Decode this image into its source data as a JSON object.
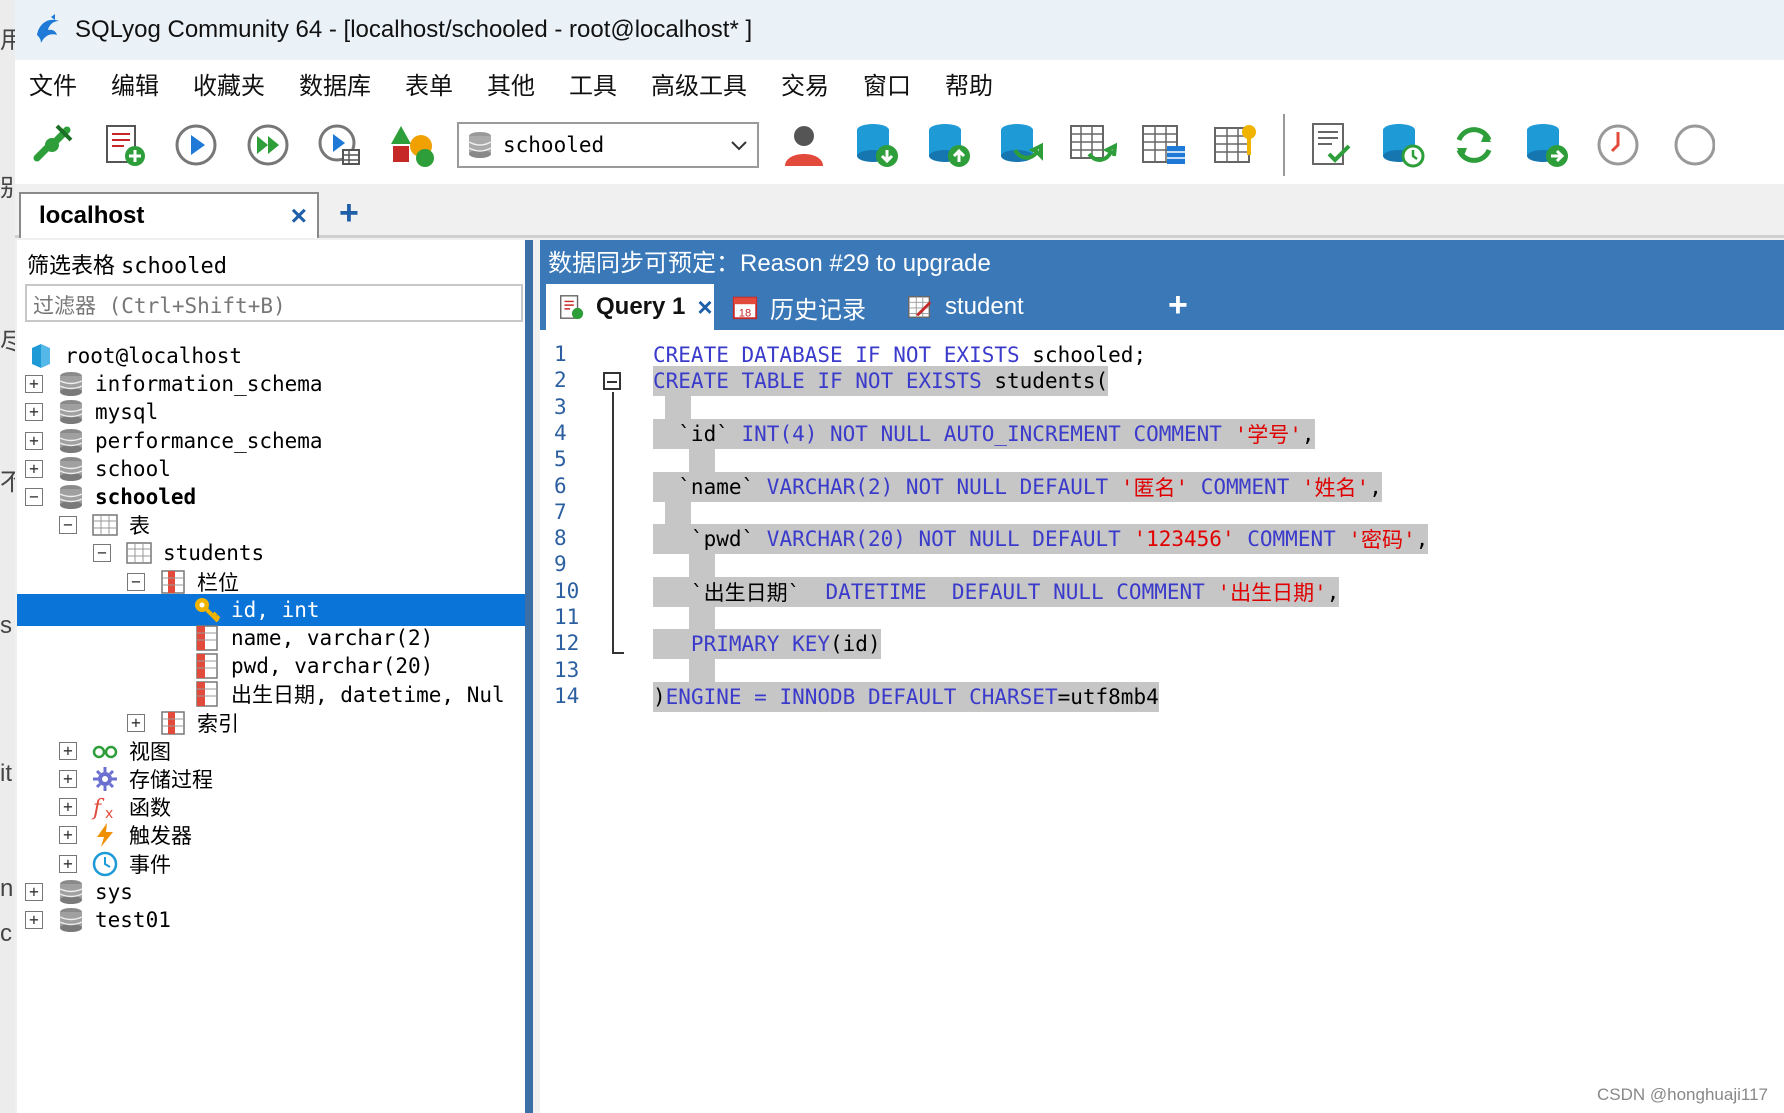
{
  "window": {
    "title": "SQLyog Community 64 - [localhost/schooled - root@localhost* ]"
  },
  "menu": [
    "文件",
    "编辑",
    "收藏夹",
    "数据库",
    "表单",
    "其他",
    "工具",
    "高级工具",
    "交易",
    "窗口",
    "帮助"
  ],
  "toolbar": {
    "db_selector_value": "schooled",
    "icons": [
      "connect-icon",
      "new-query-icon",
      "execute-query-icon",
      "execute-all-icon",
      "execute-results-icon",
      "schema-designer-icon",
      "user-manager-icon",
      "backup-icon",
      "restore-icon",
      "db-sync-icon",
      "import-table-icon",
      "table-data-icon",
      "index-icon",
      "query-builder-icon",
      "schedule-icon",
      "refresh-icon",
      "import-external-icon",
      "history-clock-icon"
    ]
  },
  "connection_tab": {
    "label": "localhost",
    "close": "×",
    "add": "+"
  },
  "left_panel": {
    "filter_title": "筛选表格",
    "filter_db": "schooled",
    "filter_placeholder": "过滤器 (Ctrl+Shift+B)",
    "tree": [
      {
        "label": "root@localhost",
        "icon": "server-icon",
        "level": 0,
        "expander": ""
      },
      {
        "label": "information_schema",
        "icon": "database-icon",
        "level": 0,
        "expander": "+"
      },
      {
        "label": "mysql",
        "icon": "database-icon",
        "level": 0,
        "expander": "+"
      },
      {
        "label": "performance_schema",
        "icon": "database-icon",
        "level": 0,
        "expander": "+"
      },
      {
        "label": "school",
        "icon": "database-icon",
        "level": 0,
        "expander": "+"
      },
      {
        "label": "schooled",
        "icon": "database-icon",
        "level": 0,
        "expander": "−",
        "bold": true
      },
      {
        "label": "表",
        "icon": "tables-folder-icon",
        "level": 1,
        "expander": "−"
      },
      {
        "label": "students",
        "icon": "table-icon",
        "level": 2,
        "expander": "−"
      },
      {
        "label": "栏位",
        "icon": "columns-icon",
        "level": 3,
        "expander": "−"
      },
      {
        "label": "id, int",
        "icon": "primary-key-icon",
        "level": 4,
        "expander": "",
        "selected": true
      },
      {
        "label": "name, varchar(2)",
        "icon": "column-icon",
        "level": 4,
        "expander": ""
      },
      {
        "label": "pwd, varchar(20)",
        "icon": "column-icon",
        "level": 4,
        "expander": ""
      },
      {
        "label": "出生日期, datetime, Nul",
        "icon": "column-icon",
        "level": 4,
        "expander": ""
      },
      {
        "label": "索引",
        "icon": "index-folder-icon",
        "level": 3,
        "expander": "+"
      },
      {
        "label": "视图",
        "icon": "views-icon",
        "level": 1,
        "expander": "+"
      },
      {
        "label": "存储过程",
        "icon": "procedures-icon",
        "level": 1,
        "expander": "+"
      },
      {
        "label": "函数",
        "icon": "functions-icon",
        "level": 1,
        "expander": "+"
      },
      {
        "label": "触发器",
        "icon": "triggers-icon",
        "level": 1,
        "expander": "+"
      },
      {
        "label": "事件",
        "icon": "events-icon",
        "level": 1,
        "expander": "+"
      },
      {
        "label": "sys",
        "icon": "database-icon",
        "level": 0,
        "expander": "+"
      },
      {
        "label": "test01",
        "icon": "database-icon",
        "level": 0,
        "expander": "+"
      }
    ]
  },
  "right_panel": {
    "banner": "数据同步可预定：Reason #29 to upgrade",
    "tabs": [
      {
        "label": "Query 1",
        "icon": "query-tab-icon",
        "active": true,
        "close": "×"
      },
      {
        "label": "历史记录",
        "icon": "calendar-icon",
        "calendar_day": "18"
      },
      {
        "label": "student",
        "icon": "table-edit-icon"
      }
    ],
    "add_tab": "+",
    "line_numbers": [
      "1",
      "2",
      "3",
      "4",
      "5",
      "6",
      "7",
      "8",
      "9",
      "10",
      "11",
      "12",
      "13",
      "14"
    ],
    "code_lines": [
      [
        {
          "t": "CREATE DATABASE IF NOT EXISTS",
          "c": "kw"
        },
        {
          "t": " schooled;",
          "c": "id"
        }
      ],
      [
        {
          "t": "CREATE TABLE IF NOT EXISTS",
          "c": "kw"
        },
        {
          "t": " students(",
          "c": "id"
        }
      ],
      [],
      [
        {
          "t": "  `id` ",
          "c": "id"
        },
        {
          "t": "INT(4) NOT NULL AUTO_INCREMENT COMMENT ",
          "c": "kw"
        },
        {
          "t": "'学号'",
          "c": "str"
        },
        {
          "t": ",",
          "c": "id"
        }
      ],
      [],
      [
        {
          "t": "  `name` ",
          "c": "id"
        },
        {
          "t": "VARCHAR(2) NOT NULL DEFAULT ",
          "c": "kw"
        },
        {
          "t": "'匿名'",
          "c": "str"
        },
        {
          "t": " COMMENT ",
          "c": "kw"
        },
        {
          "t": "'姓名'",
          "c": "str"
        },
        {
          "t": ",",
          "c": "id"
        }
      ],
      [],
      [
        {
          "t": "   `pwd` ",
          "c": "id"
        },
        {
          "t": "VARCHAR(20) NOT NULL DEFAULT ",
          "c": "kw"
        },
        {
          "t": "'123456'",
          "c": "str"
        },
        {
          "t": " COMMENT ",
          "c": "kw"
        },
        {
          "t": "'密码'",
          "c": "str"
        },
        {
          "t": ",",
          "c": "id"
        }
      ],
      [],
      [
        {
          "t": "   `出生日期` ",
          "c": "id"
        },
        {
          "t": " DATETIME  DEFAULT NULL COMMENT ",
          "c": "kw"
        },
        {
          "t": "'出生日期'",
          "c": "str"
        },
        {
          "t": ",",
          "c": "id"
        }
      ],
      [],
      [
        {
          "t": "   PRIMARY KEY",
          "c": "kw"
        },
        {
          "t": "(id)",
          "c": "id"
        }
      ],
      [],
      [
        {
          "t": ")",
          "c": "id"
        },
        {
          "t": "ENGINE = INNODB DEFAULT CHARSET",
          "c": "kw"
        },
        {
          "t": "=utf8mb4",
          "c": "id"
        }
      ]
    ]
  },
  "watermark": "CSDN @honghuaji117",
  "left_strip_chars": [
    "用",
    "别",
    "尽",
    "不",
    "s",
    "it",
    "n",
    "c"
  ]
}
